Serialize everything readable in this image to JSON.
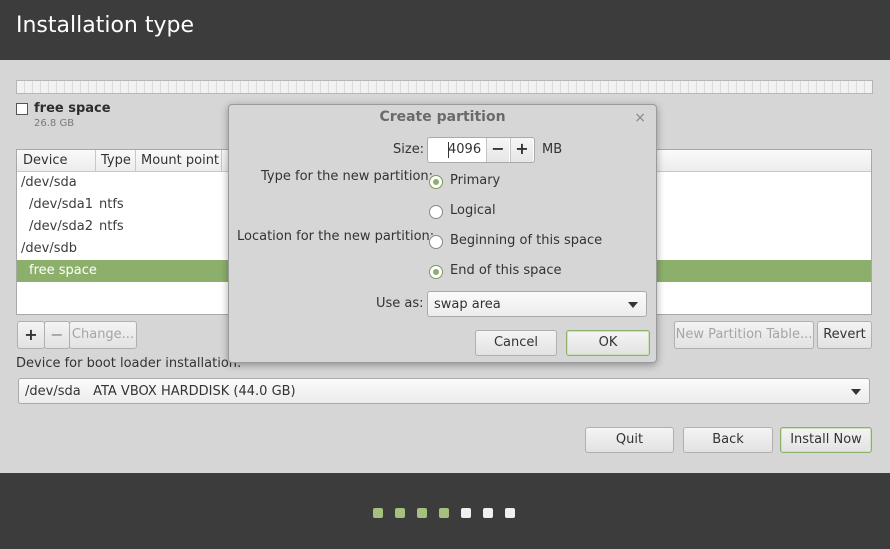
{
  "window": {
    "title": "Installation type"
  },
  "legend": {
    "name": "free space",
    "size": "26.8 GB"
  },
  "table": {
    "columns": [
      "Device",
      "Type",
      "Mount point"
    ],
    "rows": [
      {
        "device": "/dev/sda",
        "type": ""
      },
      {
        "device": "/dev/sda1",
        "type": "ntfs"
      },
      {
        "device": "/dev/sda2",
        "type": "ntfs"
      },
      {
        "device": "/dev/sdb",
        "type": ""
      },
      {
        "device": "free space",
        "type": "",
        "selected": true
      }
    ]
  },
  "toolbar": {
    "add_label": "+",
    "remove_label": "−",
    "change_label": "Change...",
    "new_table_label": "New Partition Table...",
    "revert_label": "Revert"
  },
  "boot": {
    "label": "Device for boot loader installation:",
    "value": "/dev/sda   ATA VBOX HARDDISK (44.0 GB)"
  },
  "nav": {
    "quit": "Quit",
    "back": "Back",
    "install": "Install Now"
  },
  "progress": {
    "total_steps": 7,
    "completed_steps": 4,
    "done_color": "#a5c07f",
    "todo_color": "#f0f0f0"
  },
  "dialog": {
    "title": "Create partition",
    "close_glyph": "×",
    "size_label": "Size:",
    "size_value": "4096",
    "size_unit": "MB",
    "minus": "−",
    "plus": "+",
    "type_label": "Type for the new partition:",
    "type_options": [
      "Primary",
      "Logical"
    ],
    "type_selected": "Primary",
    "location_label": "Location for the new partition:",
    "location_options": [
      "Beginning of this space",
      "End of this space"
    ],
    "location_selected": "End of this space",
    "use_as_label": "Use as:",
    "use_as_value": "swap area",
    "cancel": "Cancel",
    "ok": "OK"
  },
  "colors": {
    "accent": "#8cb06c",
    "header_bg": "#3c3c3c",
    "body_bg": "#d6d6d6"
  }
}
